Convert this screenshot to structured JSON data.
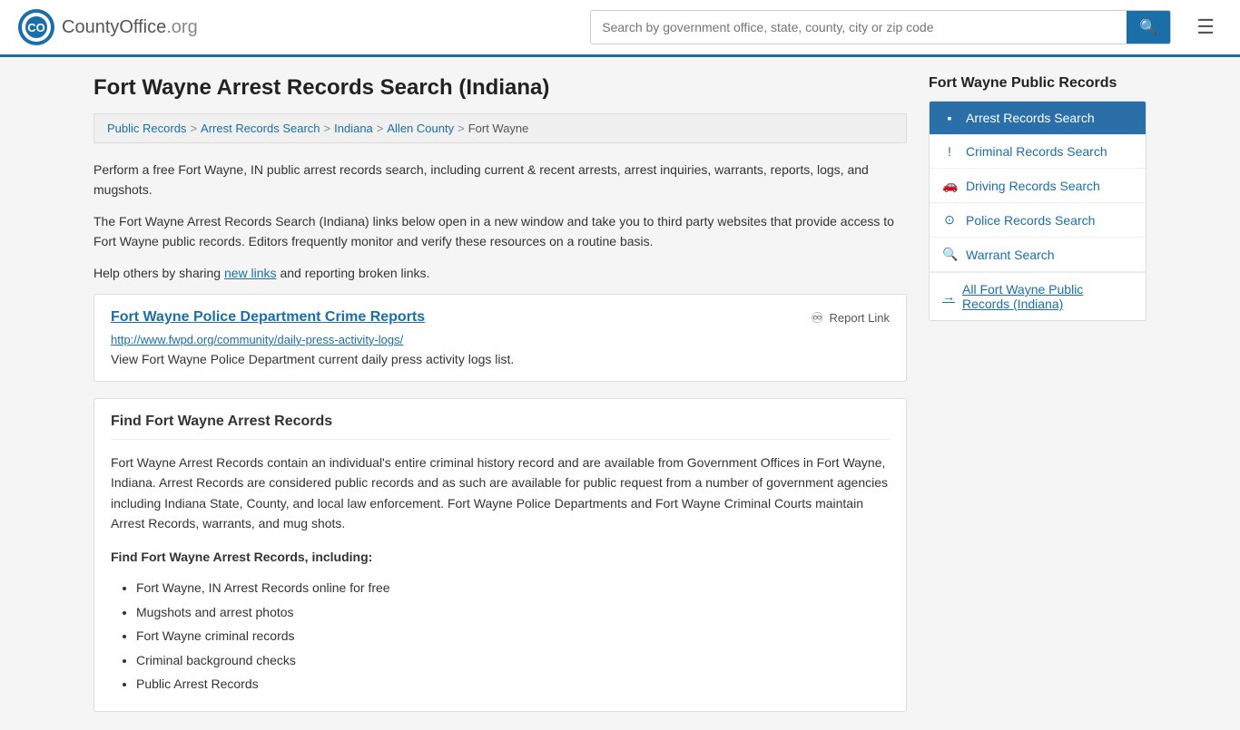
{
  "header": {
    "logo_text": "CountyOffice",
    "logo_suffix": ".org",
    "search_placeholder": "Search by government office, state, county, city or zip code",
    "search_value": ""
  },
  "breadcrumb": {
    "items": [
      "Public Records",
      "Arrest Records Search",
      "Indiana",
      "Allen County",
      "Fort Wayne"
    ]
  },
  "page": {
    "title": "Fort Wayne Arrest Records Search (Indiana)",
    "intro1": "Perform a free Fort Wayne, IN public arrest records search, including current & recent arrests, arrest inquiries, warrants, reports, logs, and mugshots.",
    "intro2": "The Fort Wayne Arrest Records Search (Indiana) links below open in a new window and take you to third party websites that provide access to Fort Wayne public records. Editors frequently monitor and verify these resources on a routine basis.",
    "intro3_prefix": "Help others by sharing ",
    "intro3_link": "new links",
    "intro3_suffix": " and reporting broken links."
  },
  "link_card": {
    "title": "Fort Wayne Police Department Crime Reports",
    "url": "http://www.fwpd.org/community/daily-press-activity-logs/",
    "description": "View Fort Wayne Police Department current daily press activity logs list.",
    "report_label": "Report Link"
  },
  "find_section": {
    "title": "Find Fort Wayne Arrest Records",
    "paragraph": "Fort Wayne Arrest Records contain an individual's entire criminal history record and are available from Government Offices in Fort Wayne, Indiana. Arrest Records are considered public records and as such are available for public request from a number of government agencies including Indiana State, County, and local law enforcement. Fort Wayne Police Departments and Fort Wayne Criminal Courts maintain Arrest Records, warrants, and mug shots.",
    "sub_title": "Find Fort Wayne Arrest Records, including:",
    "items": [
      "Fort Wayne, IN Arrest Records online for free",
      "Mugshots and arrest photos",
      "Fort Wayne criminal records",
      "Criminal background checks",
      "Public Arrest Records"
    ]
  },
  "sidebar": {
    "title": "Fort Wayne Public Records",
    "items": [
      {
        "id": "arrest-records-search",
        "label": "Arrest Records Search",
        "icon": "▪",
        "active": true
      },
      {
        "id": "criminal-records-search",
        "label": "Criminal Records Search",
        "icon": "!",
        "active": false
      },
      {
        "id": "driving-records-search",
        "label": "Driving Records Search",
        "icon": "🚗",
        "active": false
      },
      {
        "id": "police-records-search",
        "label": "Police Records Search",
        "icon": "⊙",
        "active": false
      },
      {
        "id": "warrant-search",
        "label": "Warrant Search",
        "icon": "🔍",
        "active": false
      }
    ],
    "all_link": "All Fort Wayne Public Records (Indiana)"
  }
}
